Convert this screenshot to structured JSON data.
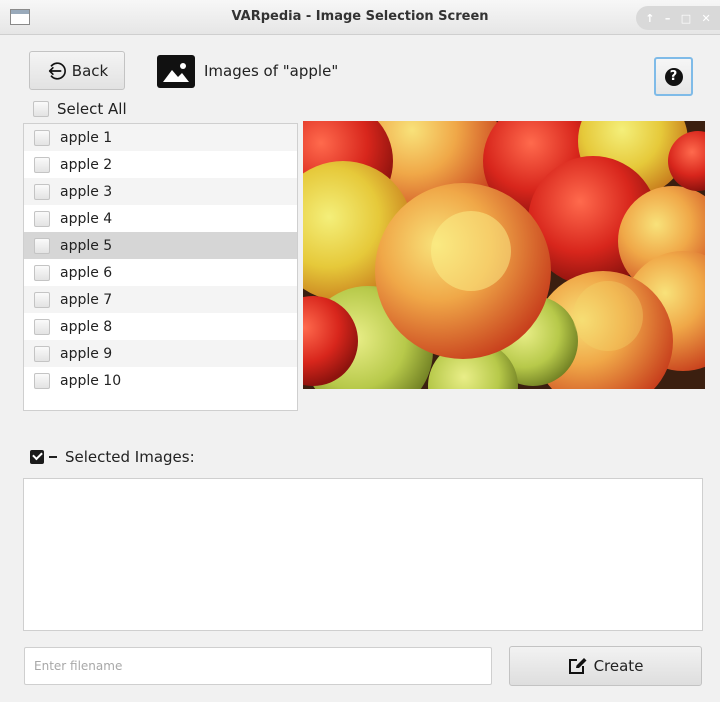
{
  "window": {
    "title": "VARpedia - Image Selection Screen",
    "controls": [
      "↑",
      "–",
      "□",
      "✕"
    ]
  },
  "header": {
    "back_label": "Back",
    "page_title": "Images of \"apple\"",
    "help_label": "?"
  },
  "select_all": {
    "label": "Select All",
    "checked": false
  },
  "images": {
    "items": [
      {
        "label": "apple 1",
        "checked": false
      },
      {
        "label": "apple 2",
        "checked": false
      },
      {
        "label": "apple 3",
        "checked": false
      },
      {
        "label": "apple 4",
        "checked": false
      },
      {
        "label": "apple 5",
        "checked": false,
        "highlighted": true
      },
      {
        "label": "apple 6",
        "checked": false
      },
      {
        "label": "apple 7",
        "checked": false
      },
      {
        "label": "apple 8",
        "checked": false
      },
      {
        "label": "apple 9",
        "checked": false
      },
      {
        "label": "apple 10",
        "checked": false
      }
    ]
  },
  "selected": {
    "label": "Selected Images:",
    "items": []
  },
  "footer": {
    "filename_placeholder": "Enter filename",
    "filename_value": "",
    "create_label": "Create"
  },
  "colors": {
    "accent": "#7fbbe8",
    "highlight_row": "#d6d6d6"
  },
  "icons": {
    "back": "back-arrow-circle-icon",
    "image": "image-icon",
    "help": "help-icon",
    "create": "edit-icon"
  }
}
